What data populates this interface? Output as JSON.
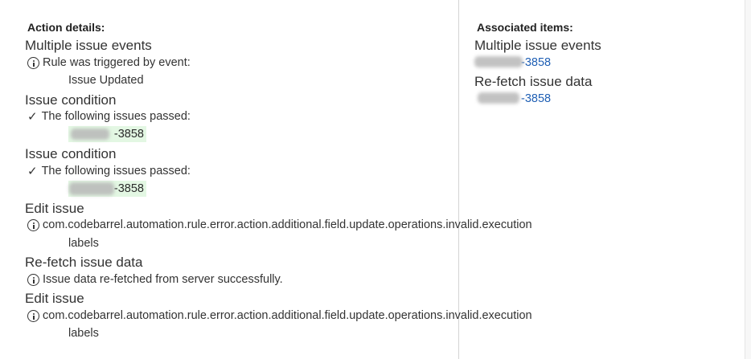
{
  "left": {
    "heading": "Action details:",
    "sections": [
      {
        "title": "Multiple issue events",
        "message": "Rule was triggered by event:",
        "detail": "Issue Updated"
      },
      {
        "title": "Issue condition",
        "message": "The following issues passed:",
        "issue": "-3858"
      },
      {
        "title": "Issue condition",
        "message": "The following issues passed:",
        "issue": "-3858"
      },
      {
        "title": "Edit issue",
        "message": "com.codebarrel.automation.rule.error.action.additional.field.update.operations.invalid.execution",
        "detail": "labels"
      },
      {
        "title": "Re-fetch issue data",
        "message": "Issue data re-fetched from server successfully."
      },
      {
        "title": "Edit issue",
        "message": "com.codebarrel.automation.rule.error.action.additional.field.update.operations.invalid.execution",
        "detail": "labels"
      }
    ]
  },
  "right": {
    "heading": "Associated items:",
    "items": [
      {
        "title": "Multiple issue events",
        "link": "-3858"
      },
      {
        "title": "Re-fetch issue data",
        "link": "-3858"
      }
    ]
  },
  "icons": {
    "info": "info-circle-icon",
    "check": "check-icon"
  },
  "colors": {
    "link": "#1f5fb4",
    "passed_bg": "#e3f7e3",
    "divider": "#d4d4d4"
  }
}
